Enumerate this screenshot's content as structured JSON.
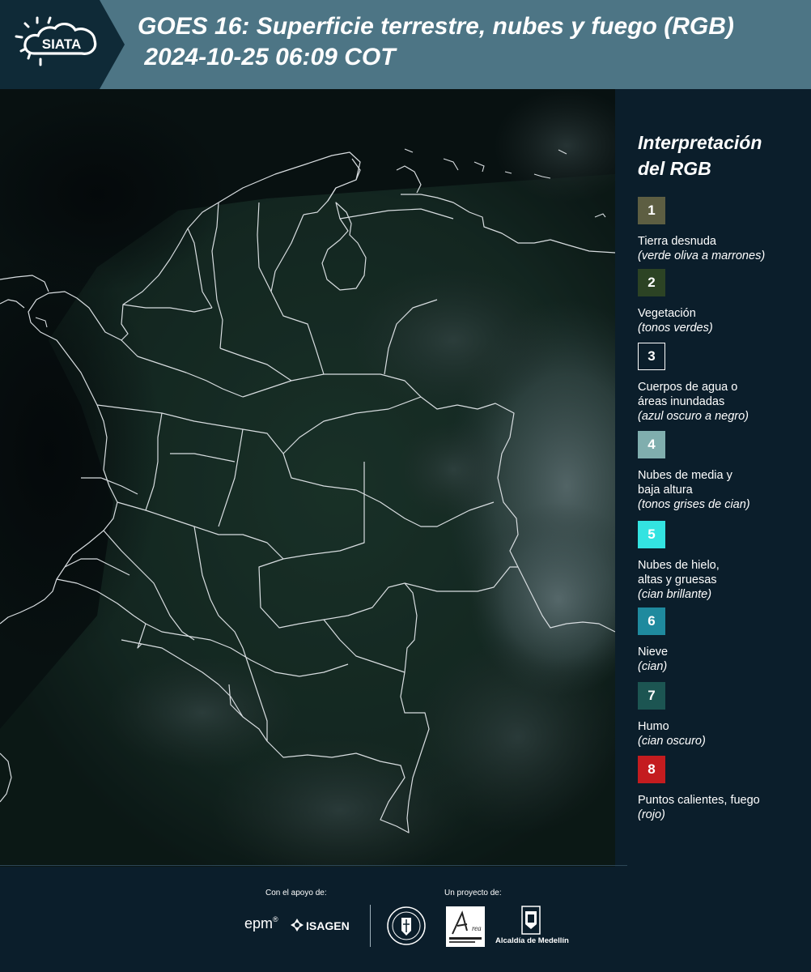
{
  "header": {
    "logo_text": "SIATA",
    "title_line1": "GOES 16: Superficie terrestre, nubes y fuego (RGB)",
    "title_line2": " 2024-10-25 06:09 COT"
  },
  "legend": {
    "title_line1": "Interpretación",
    "title_line2": "del RGB",
    "items": [
      {
        "num": "1",
        "color": "#5d5e42",
        "lines": [
          "Tierra desnuda"
        ],
        "sub": "(verde oliva a marrones)"
      },
      {
        "num": "2",
        "color": "#2c4324",
        "lines": [
          "Vegetación"
        ],
        "sub": "(tonos verdes)"
      },
      {
        "num": "3",
        "color": "#0b1e2b",
        "lines": [
          "Cuerpos de agua o",
          "áreas inundadas"
        ],
        "sub": "(azul oscuro a negro)"
      },
      {
        "num": "4",
        "color": "#80aeae",
        "lines": [
          "Nubes de media y",
          "baja altura"
        ],
        "sub": "(tonos grises de cian)"
      },
      {
        "num": "5",
        "color": "#33e3e1",
        "lines": [
          "Nubes de hielo,",
          "altas y gruesas"
        ],
        "sub": "(cian brillante)"
      },
      {
        "num": "6",
        "color": "#1f8a9e",
        "lines": [
          "Nieve"
        ],
        "sub": "(cian)"
      },
      {
        "num": "7",
        "color": "#1c5552",
        "lines": [
          "Humo"
        ],
        "sub": "(cian oscuro)"
      },
      {
        "num": "8",
        "color": "#c41c1f",
        "lines": [
          "Puntos calientes, fuego"
        ],
        "sub": "(rojo)"
      }
    ]
  },
  "footer": {
    "support_label": "Con el apoyo de:",
    "project_label": "Un proyecto de:",
    "sponsors": [
      "epm",
      "ISAGEN"
    ],
    "partners": [
      "Área Metropolitana Valle de Aburrá",
      "Alcaldía de Medellín"
    ]
  }
}
